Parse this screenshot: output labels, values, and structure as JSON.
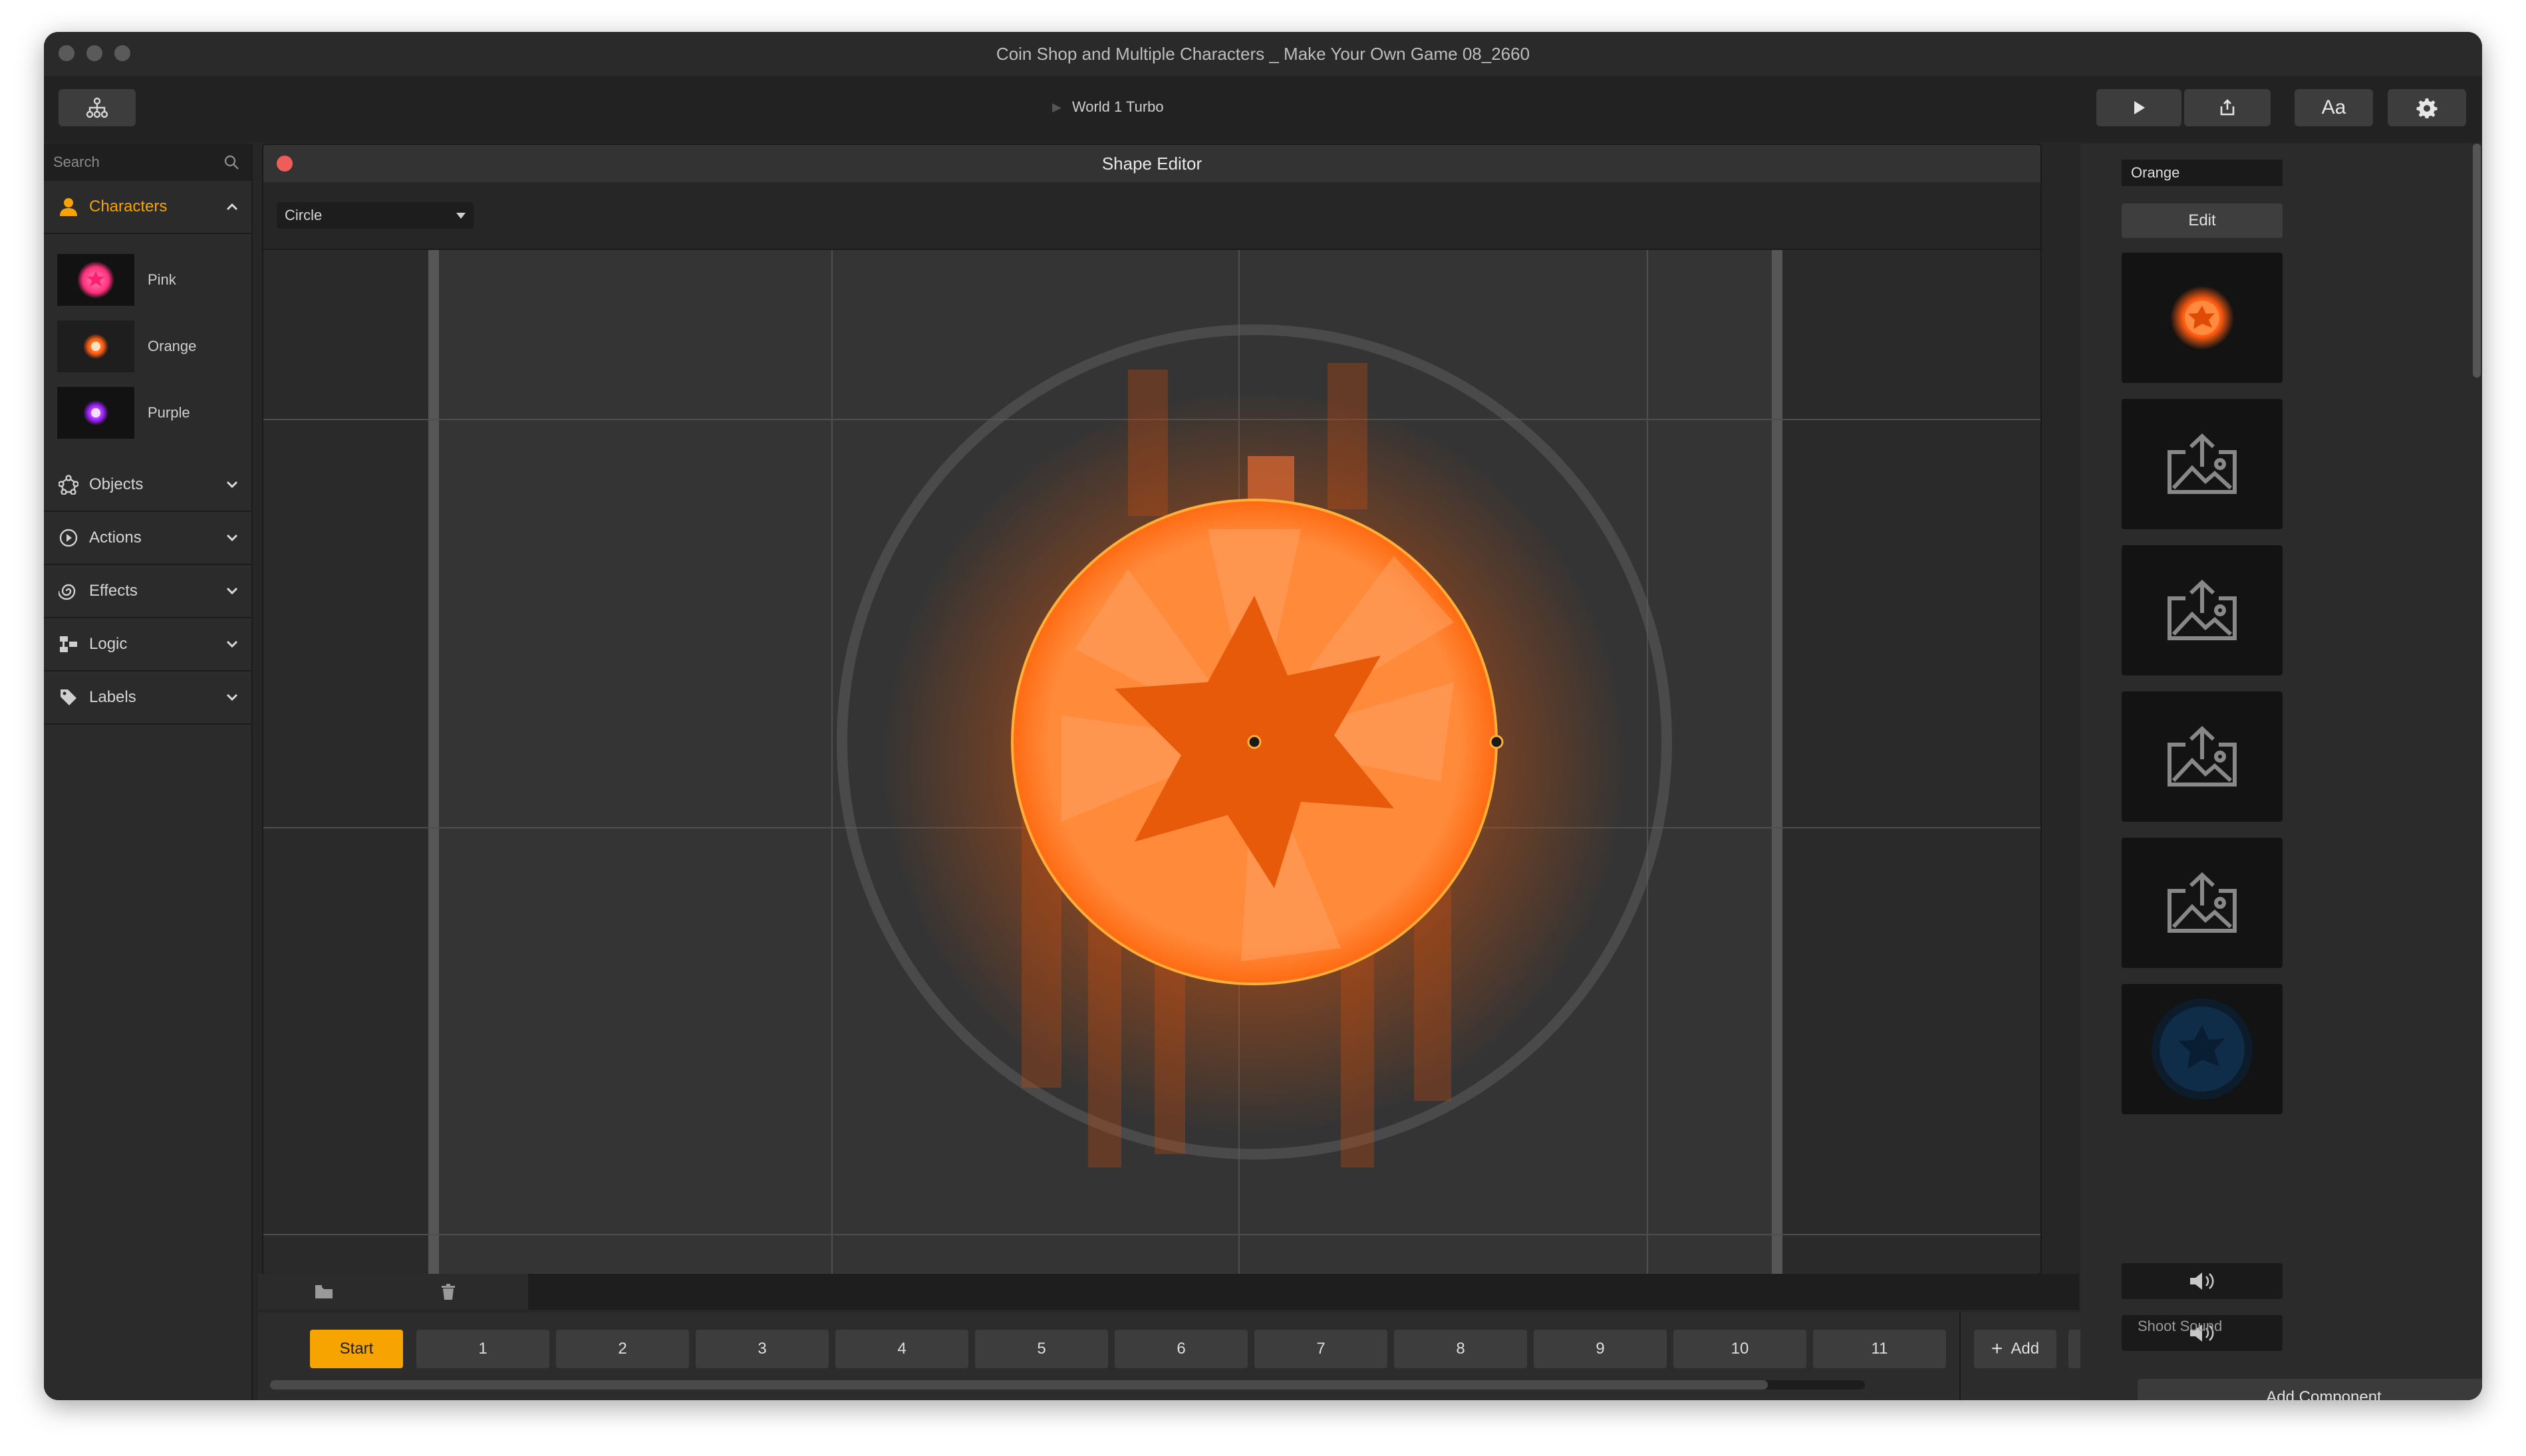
{
  "window": {
    "title": "Coin Shop and Multiple Characters _ Make Your Own Game 08_2660"
  },
  "toolbar": {
    "breadcrumb": "World 1 Turbo",
    "font_button_label": "Aa"
  },
  "sidebar": {
    "search_placeholder": "Search",
    "characters": {
      "label": "Characters",
      "items": [
        {
          "label": "Pink",
          "color": "#ff3d8a"
        },
        {
          "label": "Orange",
          "color": "#ff6a1a"
        },
        {
          "label": "Purple",
          "color": "#b030ff"
        }
      ]
    },
    "sections": [
      {
        "label": "Objects",
        "icon": "objects-icon"
      },
      {
        "label": "Actions",
        "icon": "actions-icon"
      },
      {
        "label": "Effects",
        "icon": "effects-icon"
      },
      {
        "label": "Logic",
        "icon": "logic-icon"
      },
      {
        "label": "Labels",
        "icon": "labels-icon"
      }
    ]
  },
  "editor": {
    "title": "Shape Editor",
    "shape_type": "Circle"
  },
  "scenes": {
    "start_label": "Start",
    "items": [
      "1",
      "2",
      "3",
      "4",
      "5",
      "6",
      "7",
      "8",
      "9",
      "10",
      "11"
    ],
    "add_label": "Add"
  },
  "inspector": {
    "name": "Orange",
    "edit_label": "Edit",
    "shoot_sound_label": "Shoot Sound",
    "add_component_label": "Add Component"
  },
  "colors": {
    "accent": "#f7a400",
    "shape_fill": "#ff7a1a",
    "shape_stroke": "#ffb03a"
  }
}
